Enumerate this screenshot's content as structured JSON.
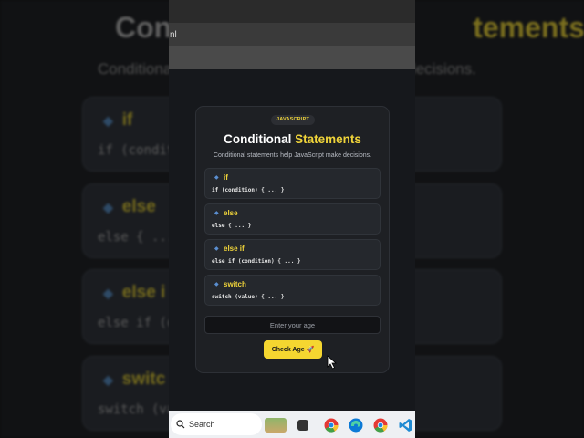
{
  "background": {
    "title_plain": "Con",
    "title_highlight": "tements",
    "subtitle": "Conditional",
    "subtitle_end": "e decisions.",
    "cards": [
      {
        "keyword": "if",
        "code": "if (conditi"
      },
      {
        "keyword": "else",
        "code": "else { ..."
      },
      {
        "keyword": "else i",
        "code": "else if (c"
      },
      {
        "keyword": "switc",
        "code": "switch (va"
      }
    ]
  },
  "browser": {
    "url_text": "nl"
  },
  "card": {
    "badge": "JAVASCRIPT",
    "title_plain": "Conditional",
    "title_highlight": "Statements",
    "subtitle": "Conditional statements help JavaScript make decisions.",
    "items": [
      {
        "keyword": "if",
        "code": "if (condition) { ... }"
      },
      {
        "keyword": "else",
        "code": "else { ... }"
      },
      {
        "keyword": "else if",
        "code": "else if (condition) { ... }"
      },
      {
        "keyword": "switch",
        "code": "switch (value) { ... }"
      }
    ],
    "input_placeholder": "Enter your age",
    "button_label": "Check Age 🚀"
  },
  "taskbar": {
    "search_label": "Search",
    "icons": [
      "widgets-icon",
      "file-explorer-icon",
      "chrome-icon",
      "edge-icon",
      "chrome-profile-icon",
      "vscode-icon"
    ]
  },
  "colors": {
    "accent": "#f5d630",
    "card_bg": "#1e2024",
    "bullet": "#5a8ed0"
  }
}
